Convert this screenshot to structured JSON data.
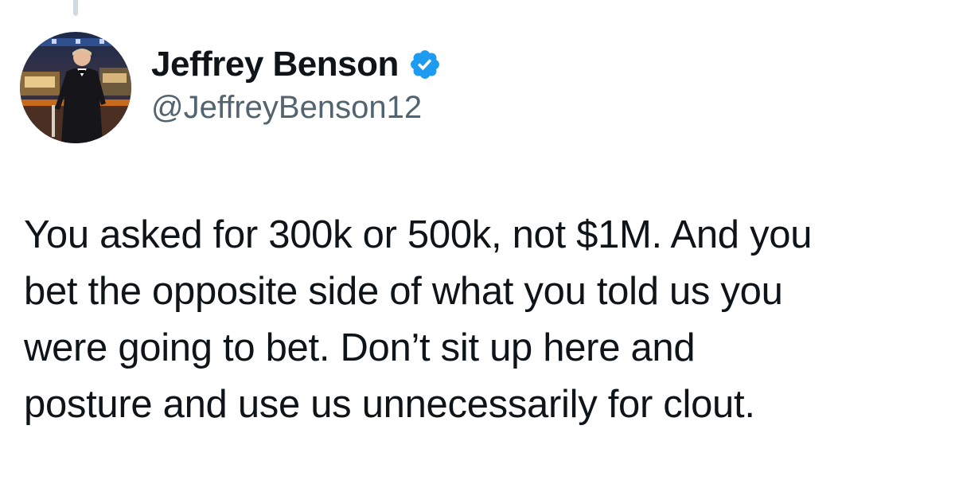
{
  "tweet": {
    "author": {
      "display_name": "Jeffrey Benson",
      "handle": "@JeffreyBenson12",
      "verified": true,
      "avatar_icon": "profile-photo-man-in-tuxedo"
    },
    "text_lines": [
      "You asked for 300k or 500k, not $1M. And you",
      "bet the opposite side of what you told us you",
      "were going to bet. Don’t sit up here and",
      "posture and use us unnecessarily for clout."
    ]
  },
  "colors": {
    "text_primary": "#0f1419",
    "text_secondary": "#536471",
    "verified_blue": "#1d9bf0",
    "thread_line": "#cfd9de"
  }
}
